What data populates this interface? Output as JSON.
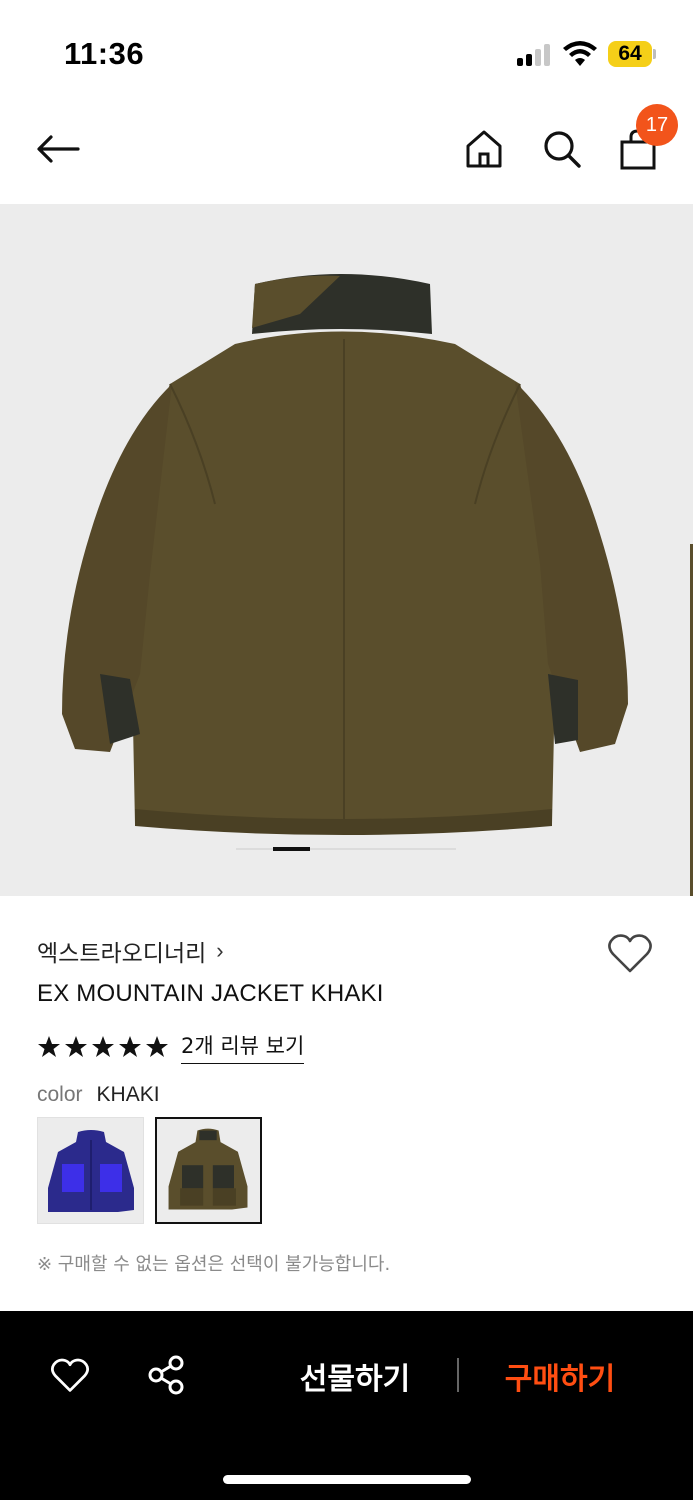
{
  "status_bar": {
    "time": "11:36",
    "battery": "64",
    "signal_icon": "cellular-signal-icon",
    "wifi_icon": "wifi-icon"
  },
  "nav": {
    "back_icon": "arrow-left-icon",
    "home_icon": "home-icon",
    "search_icon": "search-icon",
    "bag_icon": "shopping-bag-icon",
    "bag_count": "17"
  },
  "product": {
    "image_alt_icon": "jacket-back-photo",
    "carousel_position": 1,
    "brand": "엑스트라오디너리",
    "brand_chevron": "›",
    "title": "EX MOUNTAIN JACKET KHAKI",
    "rating": 5,
    "review_link": "2개 리뷰 보기",
    "color_label": "color",
    "color_value": "KHAKI",
    "swatches": [
      {
        "name": "BLUE",
        "color": "#2b2a8c",
        "selected": false
      },
      {
        "name": "KHAKI",
        "color": "#5a4e2c",
        "selected": true
      }
    ],
    "notice": "※ 구매할 수 없는 옵션은 선택이 불가능합니다.",
    "colors": {
      "jacket_khaki": "#5a4e2c",
      "jacket_dark": "#2e3029",
      "jacket_blue": "#2b2a8c",
      "jacket_blue_accent": "#3d2fe8"
    }
  },
  "bottom_bar": {
    "wish_icon": "heart-outline-icon",
    "share_icon": "share-icon",
    "gift_label": "선물하기",
    "buy_label": "구매하기",
    "buy_color": "#ff4e12"
  }
}
